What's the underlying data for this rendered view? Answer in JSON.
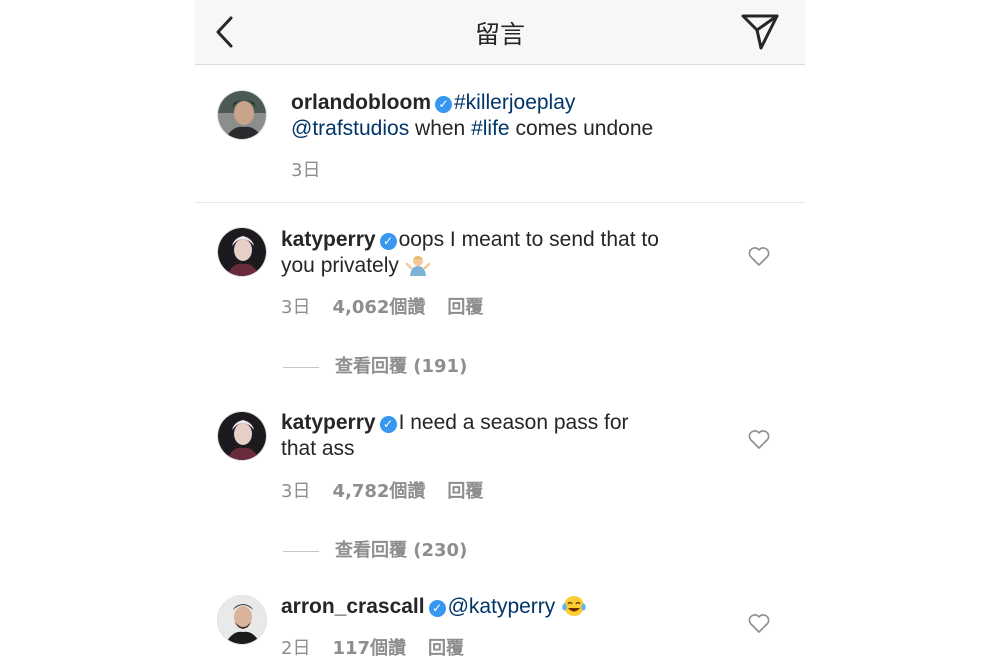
{
  "header": {
    "title": "留言"
  },
  "caption": {
    "username": "orlandobloom",
    "hashtag1": "#killerjoeplay",
    "mention": "@trafstudios",
    "text_mid": " when ",
    "hashtag2": "#life",
    "text_end": " comes undone",
    "time": "3日"
  },
  "comments": [
    {
      "username": "katyperry",
      "text_line1": "oops I meant to send that to",
      "text_line2": "you privately",
      "time": "3日",
      "likes": "4,062個讚",
      "reply": "回覆",
      "view_replies": "查看回覆 (191)"
    },
    {
      "username": "katyperry",
      "text_line1": "I need a season pass for",
      "text_line2": "that ass",
      "time": "3日",
      "likes": "4,782個讚",
      "reply": "回覆",
      "view_replies": "查看回覆 (230)"
    },
    {
      "username": "arron_crascall",
      "mention": "@katyperry",
      "time": "2日",
      "likes": "117個讚",
      "reply": "回覆"
    }
  ],
  "icons": {
    "back": "chevron-left-icon",
    "share": "direct-send-icon",
    "like": "heart-outline-icon",
    "verified": "verified-badge-icon",
    "shrug_emoji": "shrug-emoji-icon",
    "laugh_emoji": "tears-of-joy-emoji-icon"
  },
  "colors": {
    "verified": "#3897f0",
    "link": "#003569",
    "meta": "#8e8e8e"
  }
}
